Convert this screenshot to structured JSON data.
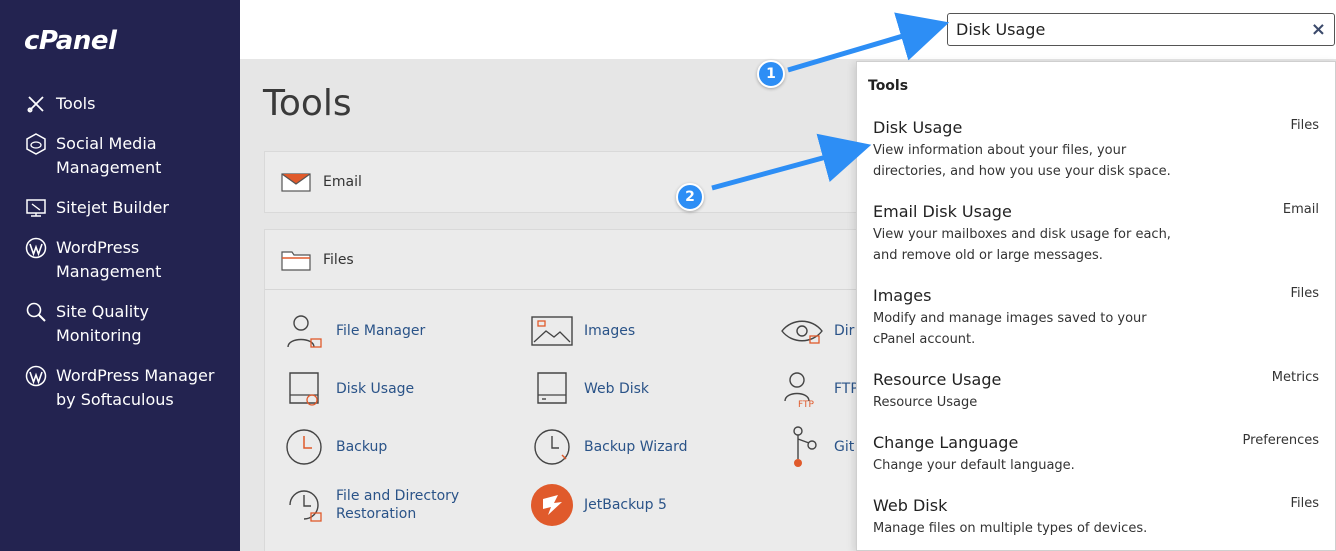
{
  "brand": {
    "logo_text": "cPanel"
  },
  "sidebar": {
    "items": [
      {
        "label": "Tools",
        "icon": "tools-icon"
      },
      {
        "label": "Social Media Management",
        "icon": "social-media-icon"
      },
      {
        "label": "Sitejet Builder",
        "icon": "sitejet-icon"
      },
      {
        "label": "WordPress Management",
        "icon": "wordpress-icon"
      },
      {
        "label": "Site Quality Monitoring",
        "icon": "site-quality-icon"
      },
      {
        "label": "WordPress Manager by Softaculous",
        "icon": "wordpress-icon"
      }
    ]
  },
  "search": {
    "value": "Disk Usage",
    "clear_label": "×"
  },
  "main": {
    "title": "Tools",
    "sections": [
      {
        "label": "Email",
        "icon": "envelope-icon"
      },
      {
        "label": "Files",
        "icon": "folder-icon"
      }
    ],
    "files_tools": [
      {
        "label": "File Manager",
        "icon": "file-manager-icon"
      },
      {
        "label": "Images",
        "icon": "images-icon"
      },
      {
        "label": "Dir",
        "icon": "directory-privacy-icon"
      },
      {
        "label": "Disk Usage",
        "icon": "disk-usage-icon"
      },
      {
        "label": "Web Disk",
        "icon": "web-disk-icon"
      },
      {
        "label": "FTP",
        "icon": "ftp-icon"
      },
      {
        "label": "Backup",
        "icon": "backup-icon"
      },
      {
        "label": "Backup Wizard",
        "icon": "backup-wizard-icon"
      },
      {
        "label": "Git",
        "icon": "git-icon"
      },
      {
        "label": "File and Directory Restoration",
        "icon": "file-restoration-icon"
      },
      {
        "label": "JetBackup 5",
        "icon": "jetbackup-icon"
      }
    ]
  },
  "dropdown": {
    "heading": "Tools",
    "items": [
      {
        "name": "Disk Usage",
        "category": "Files",
        "description": "View information about your files, your directories, and how you use your disk space."
      },
      {
        "name": "Email Disk Usage",
        "category": "Email",
        "description": "View your mailboxes and disk usage for each, and remove old or large messages."
      },
      {
        "name": "Images",
        "category": "Files",
        "description": "Modify and manage images saved to your cPanel account."
      },
      {
        "name": "Resource Usage",
        "category": "Metrics",
        "description": "Resource Usage"
      },
      {
        "name": "Change Language",
        "category": "Preferences",
        "description": "Change your default language."
      },
      {
        "name": "Web Disk",
        "category": "Files",
        "description": "Manage files on multiple types of devices."
      }
    ]
  },
  "callouts": [
    "1",
    "2"
  ],
  "colors": {
    "sidebar": "#232350",
    "link": "#2a5388",
    "callout": "#2d8ef5",
    "accent_orange": "#e05a2b"
  }
}
